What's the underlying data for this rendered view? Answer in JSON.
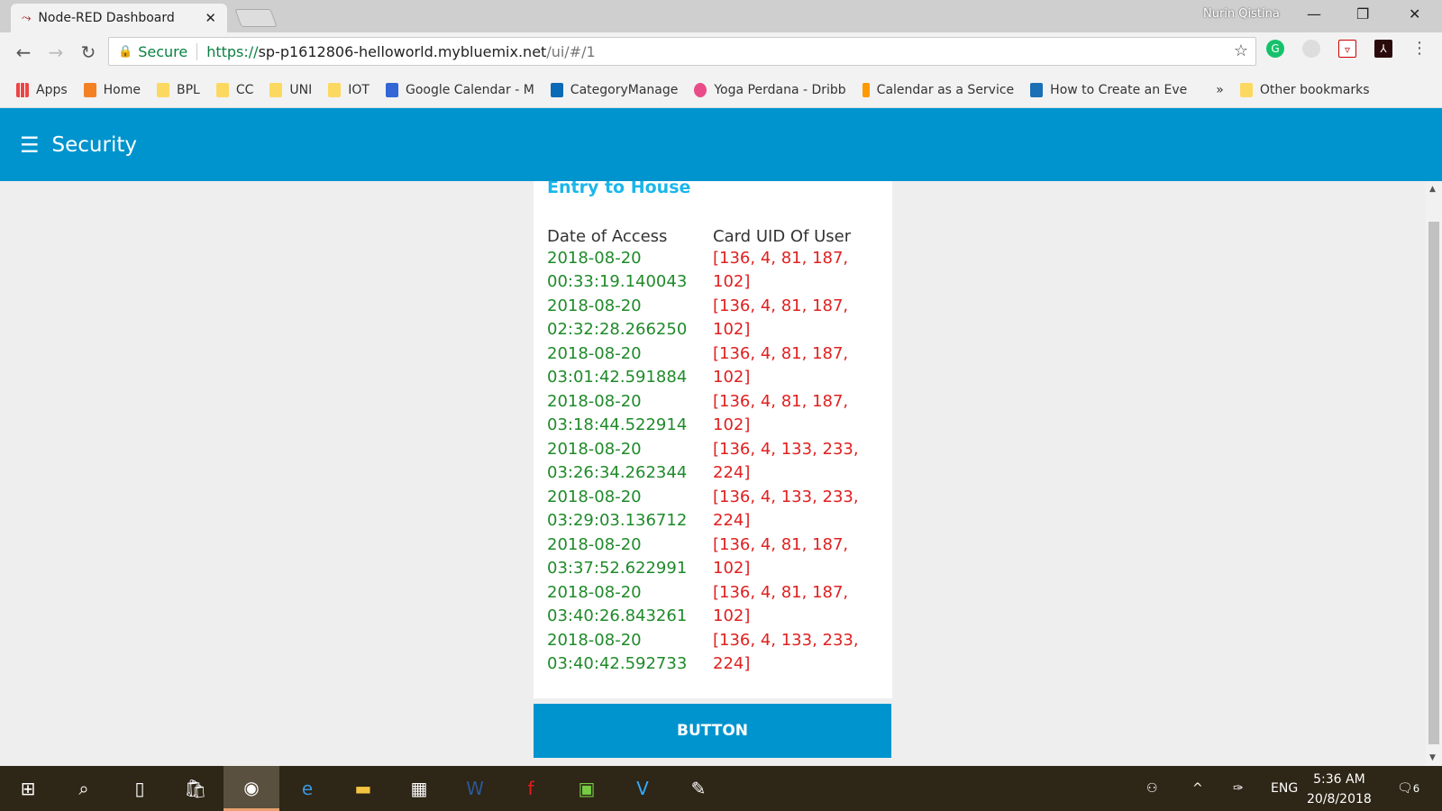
{
  "browser": {
    "tab_title": "Node-RED Dashboard",
    "user": "Nurin Qistina",
    "secure_label": "Secure",
    "url_scheme": "https://",
    "url_host": "sp-p1612806-helloworld.mybluemix.net",
    "url_path": "/ui/#/1",
    "bookmarks": [
      "Apps",
      "Home",
      "BPL",
      "CC",
      "UNI",
      "IOT",
      "Google Calendar - M",
      "CategoryManage",
      "Yoga Perdana - Dribb",
      "Calendar as a Service",
      "How to Create an Eve"
    ],
    "more": "»",
    "other_bookmarks": "Other bookmarks"
  },
  "header": {
    "title": "Security"
  },
  "card": {
    "title": "Entry to House",
    "columns": [
      "Date of Access",
      "Card UID Of User"
    ],
    "rows": [
      {
        "date": "2018-08-20 00:33:19.140043",
        "uid": "[136, 4, 81, 187, 102]"
      },
      {
        "date": "2018-08-20 02:32:28.266250",
        "uid": "[136, 4, 81, 187, 102]"
      },
      {
        "date": "2018-08-20 03:01:42.591884",
        "uid": "[136, 4, 81, 187, 102]"
      },
      {
        "date": "2018-08-20 03:18:44.522914",
        "uid": "[136, 4, 81, 187, 102]"
      },
      {
        "date": "2018-08-20 03:26:34.262344",
        "uid": "[136, 4, 133, 233, 224]"
      },
      {
        "date": "2018-08-20 03:29:03.136712",
        "uid": "[136, 4, 133, 233, 224]"
      },
      {
        "date": "2018-08-20 03:37:52.622991",
        "uid": "[136, 4, 81, 187, 102]"
      },
      {
        "date": "2018-08-20 03:40:26.843261",
        "uid": "[136, 4, 81, 187, 102]"
      },
      {
        "date": "2018-08-20 03:40:42.592733",
        "uid": "[136, 4, 133, 233, 224]"
      }
    ]
  },
  "button": {
    "label": "BUTTON"
  },
  "taskbar": {
    "lang": "ENG",
    "time": "5:36 AM",
    "date": "20/8/2018",
    "notifications": "6"
  },
  "colors": {
    "header": "#0094ce",
    "date_text": "#1f8a2a",
    "uid_text": "#e02020",
    "card_title": "#1bb6ea"
  }
}
